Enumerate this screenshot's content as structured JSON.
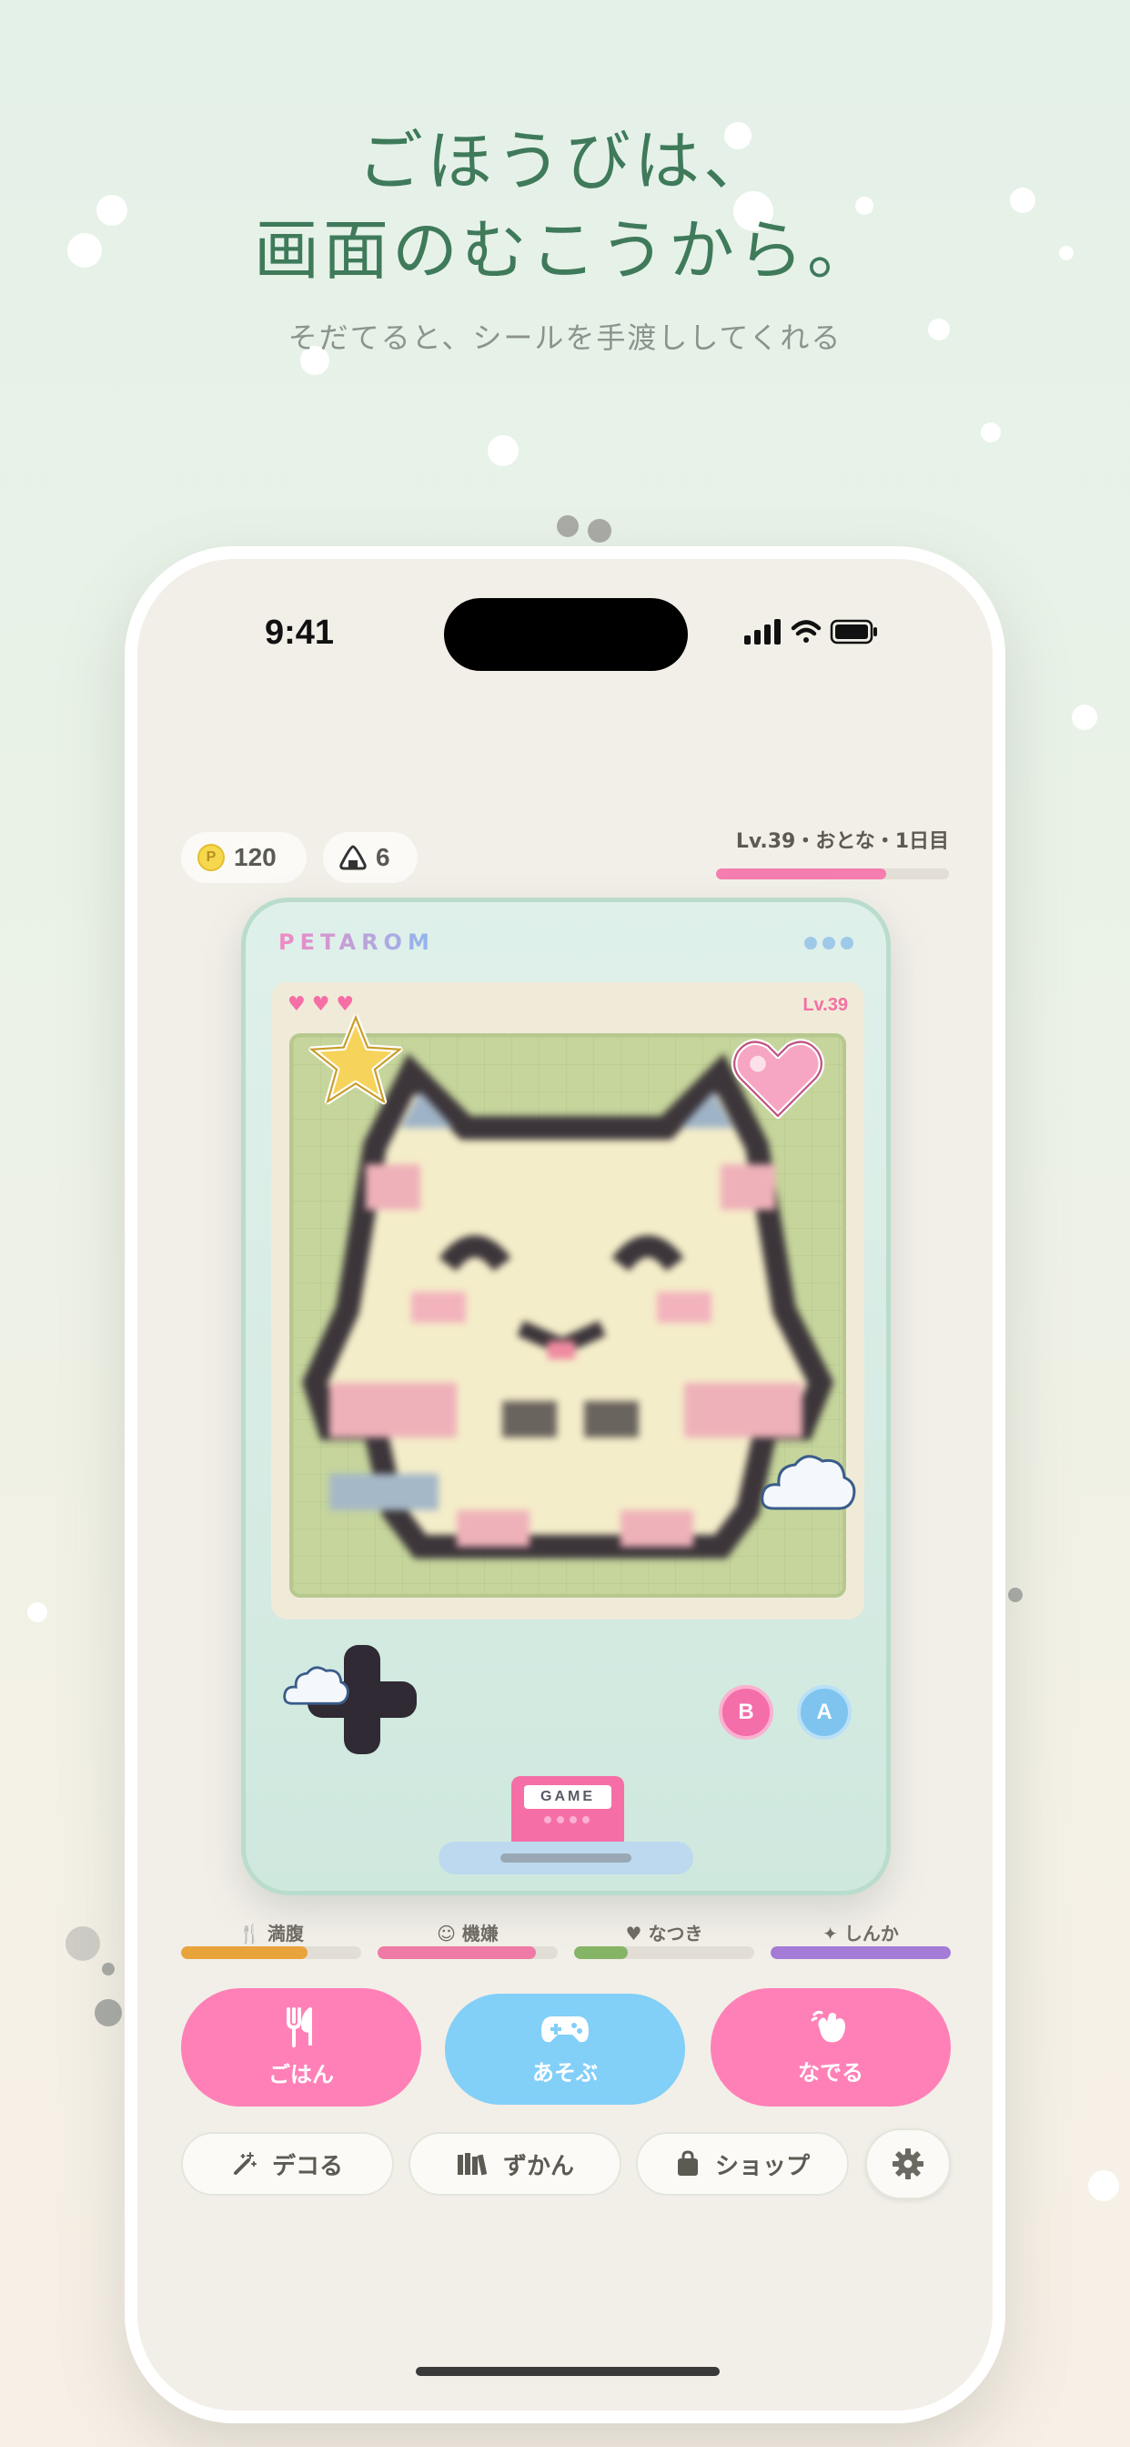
{
  "headline": {
    "line1": "ごほうびは、",
    "line2": "画面のむこうから。",
    "sub": "そだてると、シールを手渡ししてくれる"
  },
  "status_bar": {
    "time": "9:41"
  },
  "top": {
    "coins": "120",
    "onigiri": "6",
    "level_text": "Lv.39・おとな・1日目",
    "level_progress": 0.73
  },
  "device": {
    "brand": "PETAROM",
    "hearts": "♥ ♥ ♥",
    "lcd_level": "Lv.39",
    "button_b": "B",
    "button_a": "A",
    "cartridge": "GAME"
  },
  "stats": [
    {
      "label": "🍴 満腹",
      "value": 0.7,
      "color": "#e9a33b"
    },
    {
      "label": "☺ 機嫌",
      "value": 0.88,
      "color": "#ef7aa5"
    },
    {
      "label": "♥ なつき",
      "value": 0.3,
      "color": "#86b467"
    },
    {
      "label": "✦ しんか",
      "value": 1.0,
      "color": "#a47bd6"
    }
  ],
  "actions": [
    {
      "label": "ごはん",
      "icon": "fork-knife-icon",
      "color": "#ff80b7"
    },
    {
      "label": "あそぶ",
      "icon": "gamepad-icon",
      "color": "#82cff8"
    },
    {
      "label": "なでる",
      "icon": "pet-hand-icon",
      "color": "#ff80b7"
    }
  ],
  "menu": [
    {
      "label": "デコる",
      "icon": "magic-wand-icon"
    },
    {
      "label": "ずかん",
      "icon": "books-icon"
    },
    {
      "label": "ショップ",
      "icon": "shopping-bag-icon"
    },
    {
      "label": "",
      "icon": "gear-icon"
    }
  ]
}
